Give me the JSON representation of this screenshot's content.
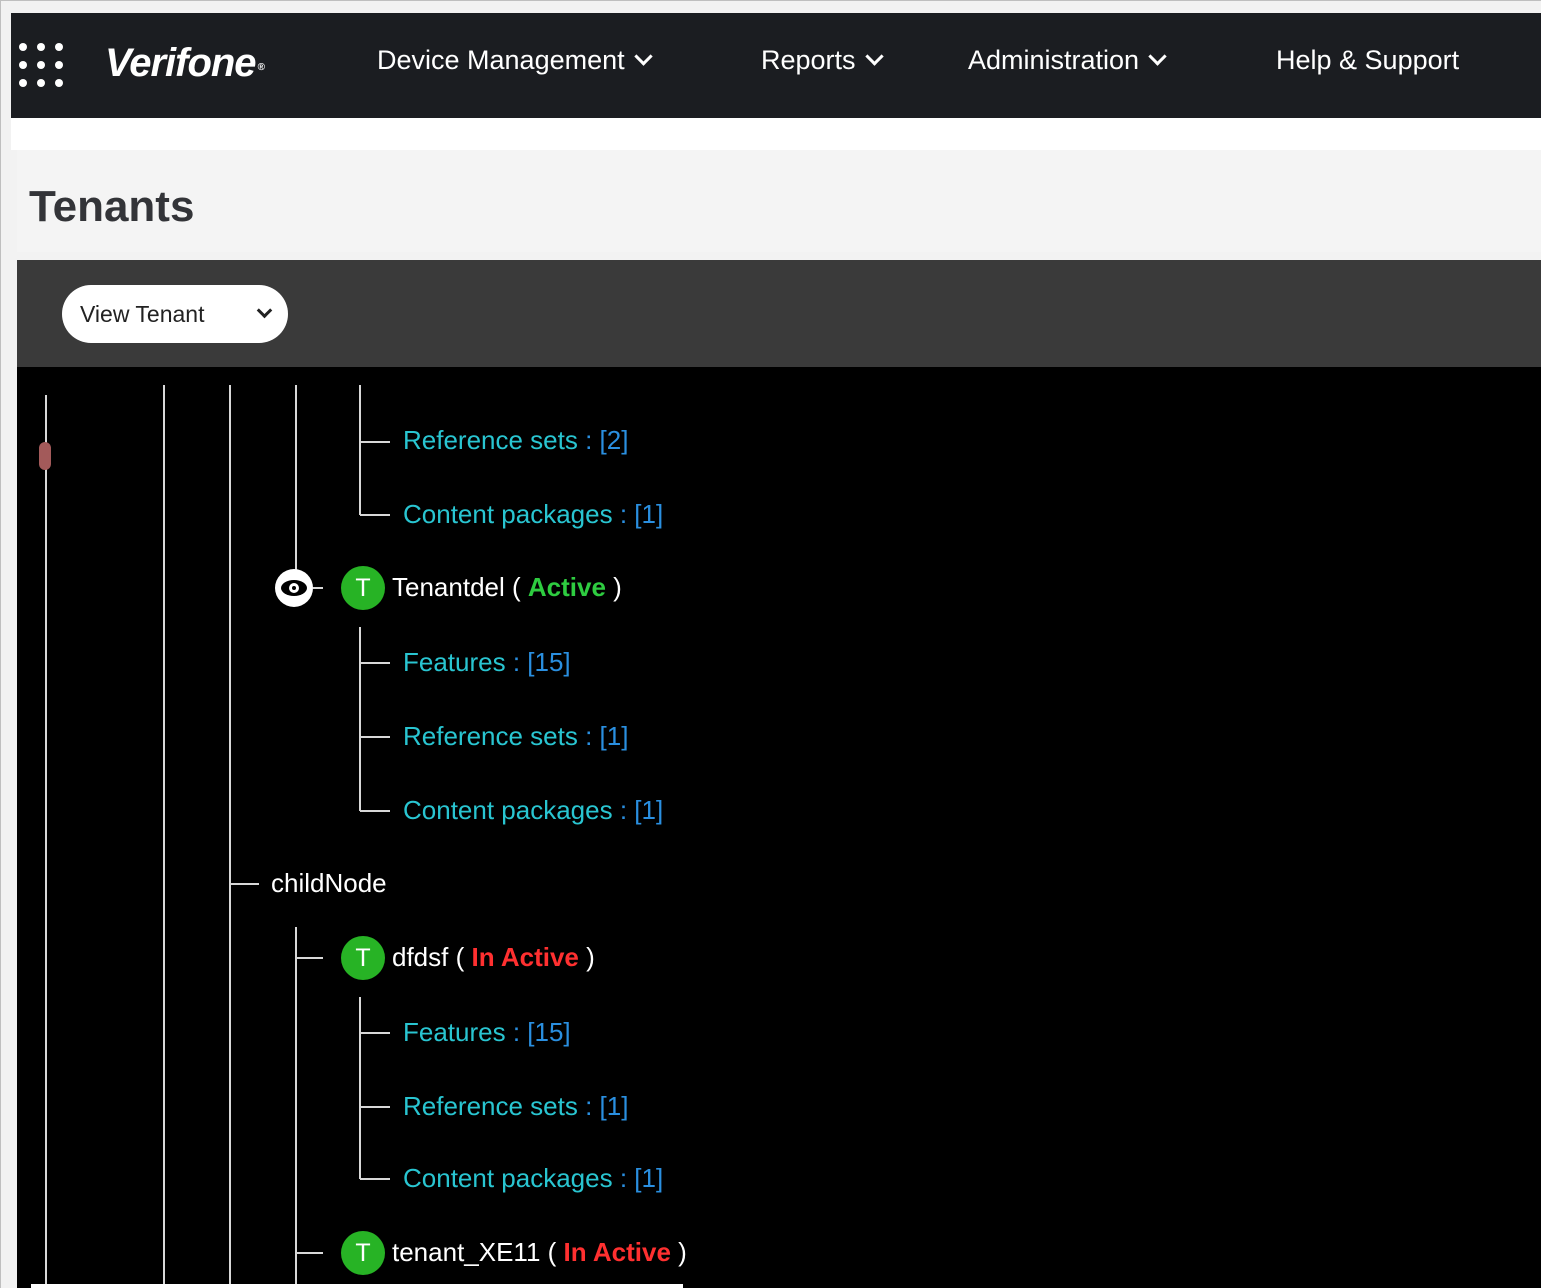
{
  "nav": {
    "brand": "Verifone",
    "brand_mark": "®",
    "items": [
      {
        "label": "Device Management",
        "has_dropdown": true
      },
      {
        "label": "Reports",
        "has_dropdown": true
      },
      {
        "label": "Administration",
        "has_dropdown": true
      },
      {
        "label": "Help & Support",
        "has_dropdown": false
      }
    ]
  },
  "page": {
    "title": "Tenants"
  },
  "toolbar": {
    "view_select": {
      "selected": "View Tenant"
    }
  },
  "tree": {
    "nodes": [
      {
        "label": "Reference sets",
        "sep": " : ",
        "count": "[2]"
      },
      {
        "label": "Content packages",
        "sep": " : ",
        "count": "[1]"
      },
      {
        "name": "Tenantdel",
        "badge": "T",
        "open": " ( ",
        "status": "Active",
        "close": " )",
        "status_color": "green"
      },
      {
        "label": "Features",
        "sep": " : ",
        "count": "[15]"
      },
      {
        "label": "Reference sets",
        "sep": " : ",
        "count": "[1]"
      },
      {
        "label": "Content packages",
        "sep": " : ",
        "count": "[1]"
      },
      {
        "label": "childNode"
      },
      {
        "name": "dfdsf",
        "badge": "T",
        "open": " ( ",
        "status": "In Active",
        "close": " )",
        "status_color": "red"
      },
      {
        "label": "Features",
        "sep": " : ",
        "count": "[15]"
      },
      {
        "label": "Reference sets",
        "sep": " : ",
        "count": "[1]"
      },
      {
        "label": "Content packages",
        "sep": " : ",
        "count": "[1]"
      },
      {
        "name": "tenant_XE11",
        "badge": "T",
        "open": " ( ",
        "status": "In Active",
        "close": " )",
        "status_color": "red"
      }
    ]
  },
  "colors": {
    "nav_bg": "#1b1d21",
    "tree_bg": "#000000",
    "toolbar_bg": "#3a3a3a",
    "leaf_text": "#29c5d1",
    "count_text": "#2a8fe0",
    "active": "#2ecc40",
    "inactive": "#ff3030",
    "badge": "#27b325"
  },
  "icons": {
    "apps": "apps-grid-icon",
    "view": "eye-icon",
    "dropdown": "chevron-down-icon"
  }
}
